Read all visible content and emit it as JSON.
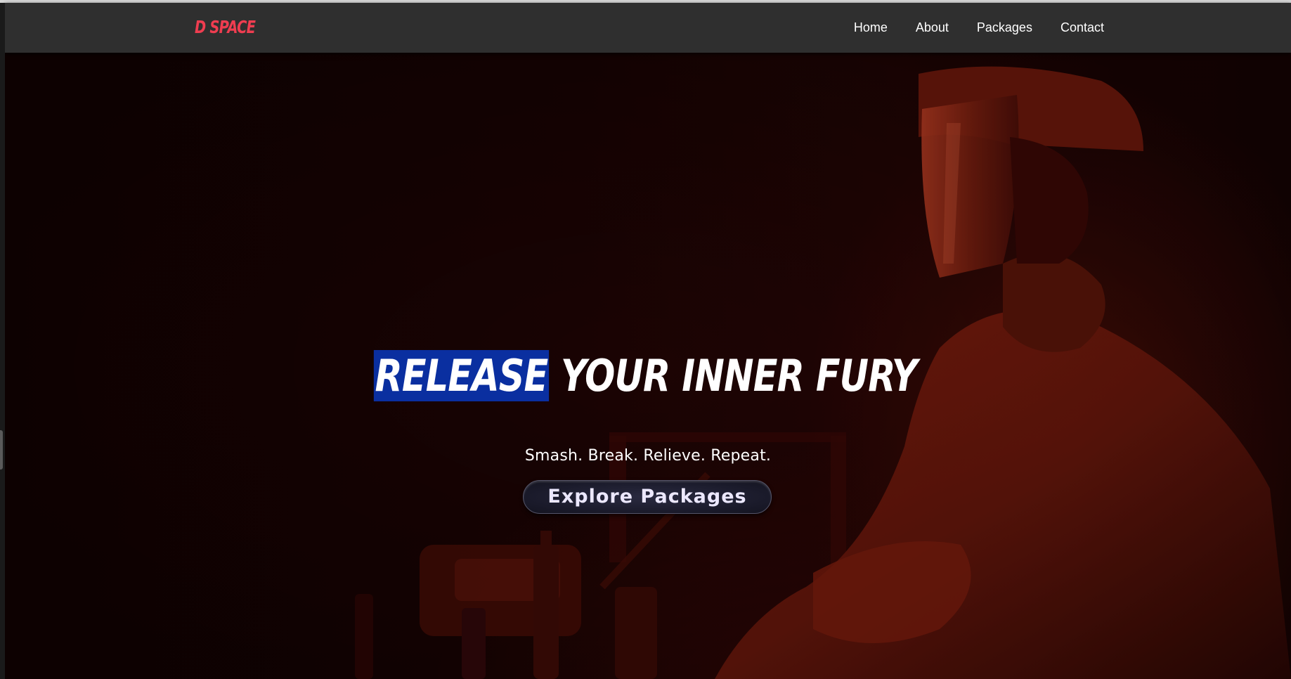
{
  "navbar": {
    "logo": "D SPACE",
    "links": [
      "Home",
      "About",
      "Packages",
      "Contact"
    ]
  },
  "hero": {
    "headline_highlight": "RELEASE",
    "headline_rest": " YOUR INNER FURY",
    "tagline": "Smash. Break. Relieve. Repeat.",
    "cta_label": "Explore Packages",
    "background_image": "person wearing face shield and protective suit in red-lit room with bottles"
  },
  "colors": {
    "logo": "#ef3d50",
    "navbar_bg": "#2f2f2f",
    "highlight_bg": "#0a2fa0",
    "hero_tint": "#3a0a06",
    "cta_text": "#ece8ff"
  }
}
